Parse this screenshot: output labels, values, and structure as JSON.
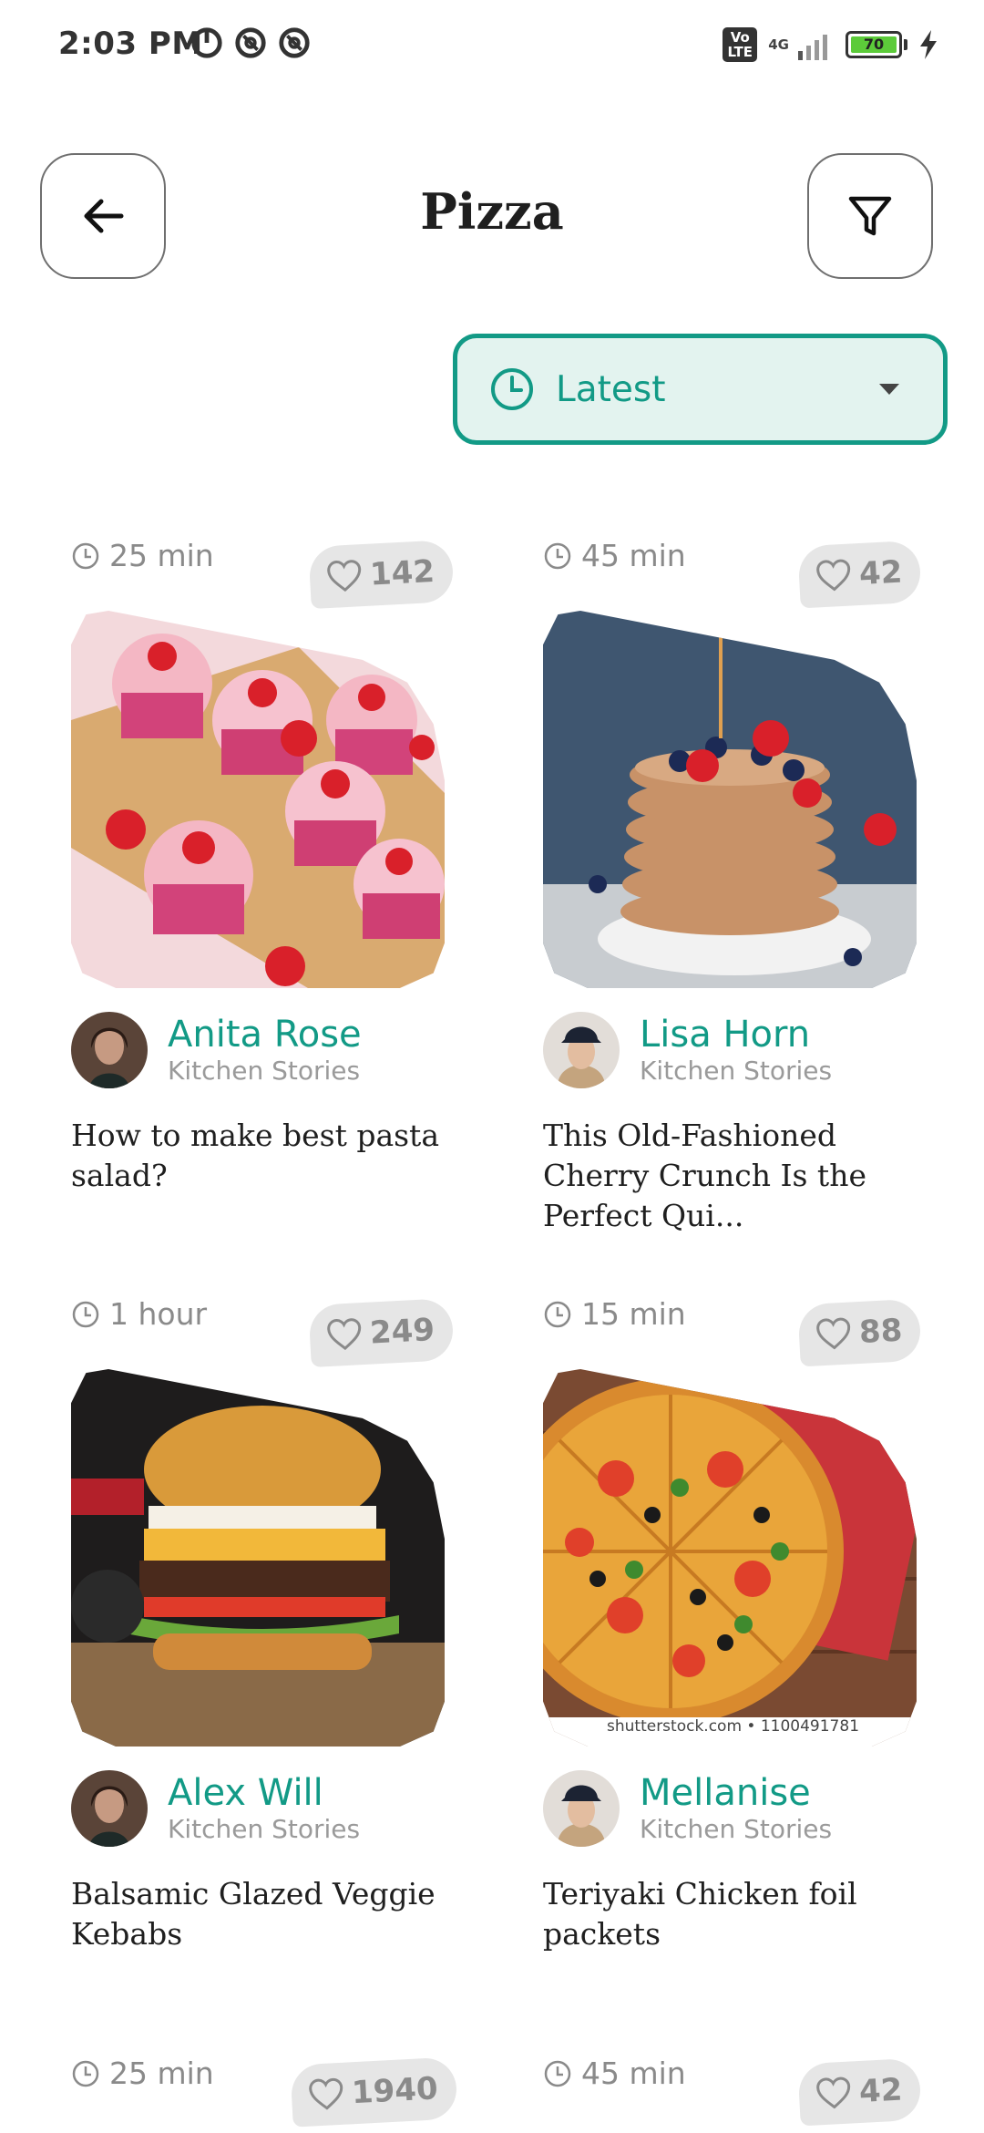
{
  "status_bar": {
    "time": "2:03 PM",
    "network_label": "4G",
    "volte_label": "Vo LTE",
    "battery_level": "70",
    "icons": [
      "sync-icon",
      "at-icon",
      "at-icon",
      "volte-icon",
      "signal-icon",
      "battery-icon",
      "charging-icon"
    ]
  },
  "header": {
    "title": "Pizza",
    "back_icon": "arrow-left-icon",
    "filter_icon": "filter-icon"
  },
  "sort": {
    "selected": "Latest",
    "icon": "clock-icon"
  },
  "colors": {
    "accent": "#129a86",
    "accent_bg": "#e3f3ef",
    "muted": "#8a8a8a",
    "badge_bg": "#e6e6e6"
  },
  "recipes": [
    {
      "time": "25 min",
      "likes": "142",
      "author": "Anita Rose",
      "source": "Kitchen Stories",
      "title": "How to make best pasta salad?",
      "image": "cupcakes-photo"
    },
    {
      "time": "45 min",
      "likes": "42",
      "author": "Lisa Horn",
      "source": "Kitchen Stories",
      "title": "This Old-Fashioned Cherry Crunch Is the Perfect Qui...",
      "image": "pancakes-photo"
    },
    {
      "time": "1 hour",
      "likes": "249",
      "author": "Alex Will",
      "source": "Kitchen Stories",
      "title": "Balsamic Glazed Veggie Kebabs",
      "image": "burger-photo"
    },
    {
      "time": "15 min",
      "likes": "88",
      "author": "Mellanise",
      "source": "Kitchen Stories",
      "title": "Teriyaki Chicken foil packets",
      "image": "pizza-photo",
      "watermark": "shutterstock.com • 1100491781"
    },
    {
      "time": "25 min",
      "likes": "1940"
    },
    {
      "time": "45 min",
      "likes": "42"
    }
  ]
}
